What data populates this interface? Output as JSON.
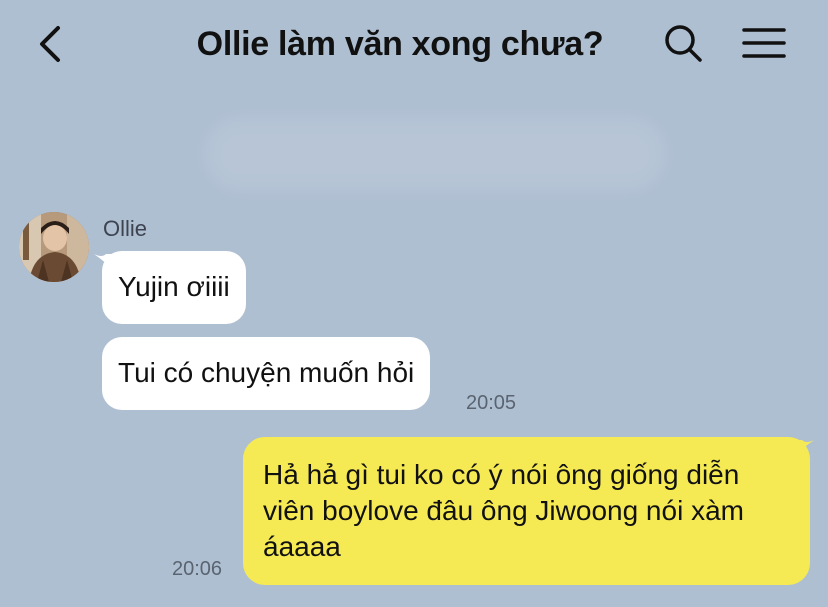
{
  "header": {
    "title": "Ollie làm văn xong chưa?",
    "back_icon": "chevron-left-icon",
    "search_icon": "search-icon",
    "menu_icon": "hamburger-menu-icon"
  },
  "colors": {
    "background": "#afbfd2",
    "incoming_bubble": "#ffffff",
    "outgoing_bubble": "#f6ea54"
  },
  "messages": {
    "incoming": {
      "sender": "Ollie",
      "items": [
        {
          "text": "Yujin ơiiii"
        },
        {
          "text": "Tui có chuyện muốn hỏi",
          "time": "20:05"
        }
      ]
    },
    "outgoing": {
      "text": "Hả hả gì tui ko có ý nói ông giống diễn viên boylove đâu ông Jiwoong nói xàm áaaaa",
      "time": "20:06"
    }
  }
}
